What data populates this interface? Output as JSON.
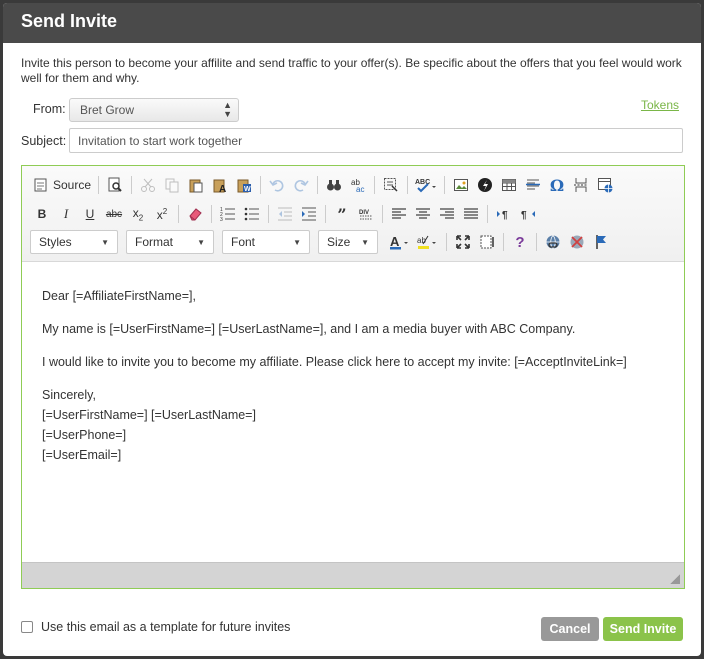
{
  "dialog": {
    "title": "Send Invite"
  },
  "intro": "Invite this person to become your affilite and send traffic to your offer(s). Be specific about the offers that you feel would work well for them and why.",
  "form": {
    "from_label": "From:",
    "from_value": "Bret Grow",
    "tokens_link": "Tokens",
    "subject_label": "Subject:",
    "subject_value": "Invitation to start work together"
  },
  "toolbar": {
    "source_label": "Source",
    "styles_label": "Styles",
    "format_label": "Format",
    "font_label": "Font",
    "size_label": "Size",
    "omega": "Ω",
    "help": "?"
  },
  "email": {
    "greeting": "Dear [=AffiliateFirstName=],",
    "para1": "My name is [=UserFirstName=] [=UserLastName=], and I am a media buyer with ABC Company.",
    "para2": "I would like to invite you to become my affiliate. Please click here to accept my invite: [=AcceptInviteLink=]",
    "closing": "Sincerely,",
    "sig_name": "[=UserFirstName=] [=UserLastName=]",
    "sig_phone": "[=UserPhone=]",
    "sig_email": "[=UserEmail=]"
  },
  "footer": {
    "template_checkbox_label": "Use this email as a template for future invites",
    "template_checked": false,
    "cancel_label": "Cancel",
    "send_label": "Send Invite"
  },
  "colors": {
    "header_bg": "#4a4a4a",
    "accent_green": "#8bc34a",
    "link_green": "#7ab648",
    "cancel_gray": "#999999"
  }
}
